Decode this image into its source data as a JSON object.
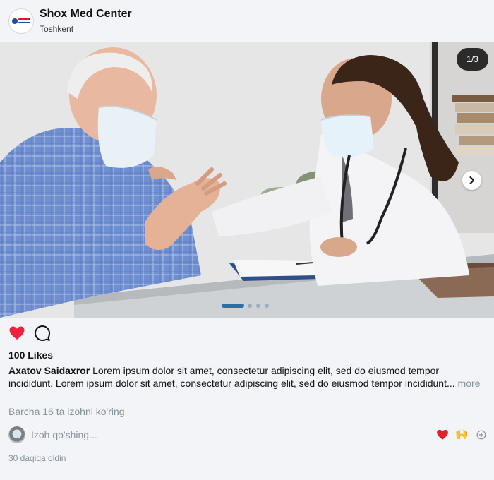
{
  "account": {
    "name": "Shox Med Center",
    "location": "Toshkent"
  },
  "media": {
    "counter": "1/3",
    "total_slides": 3,
    "active_slide": 1
  },
  "post": {
    "likes": "100 Likes",
    "author": "Axatov Saidaxror",
    "caption": "Lorem ipsum dolor sit amet, consectetur adipiscing elit, sed do eiusmod tempor incididunt. Lorem ipsum dolor sit amet, consectetur adipiscing elit, sed do eiusmod tempor incididunt...",
    "more_label": "more",
    "view_comments": "Barcha 16 ta izohni ko'ring",
    "time": "30 daqiqa oldin"
  },
  "comment_box": {
    "placeholder": "Izoh qo'shing...",
    "value": "",
    "quick_reactions": [
      "❤️",
      "🙌"
    ]
  },
  "colors": {
    "background": "#f2f4f8",
    "like_red": "#f0213d",
    "muted_text": "#8a919c",
    "counter_bg": "#2b2b2b",
    "dot_active": "#2a6fa8"
  },
  "icons": {
    "like": "heart-icon",
    "comment": "comment-bubble-icon",
    "next": "chevron-right-icon",
    "add_reaction": "plus-circle-icon"
  }
}
